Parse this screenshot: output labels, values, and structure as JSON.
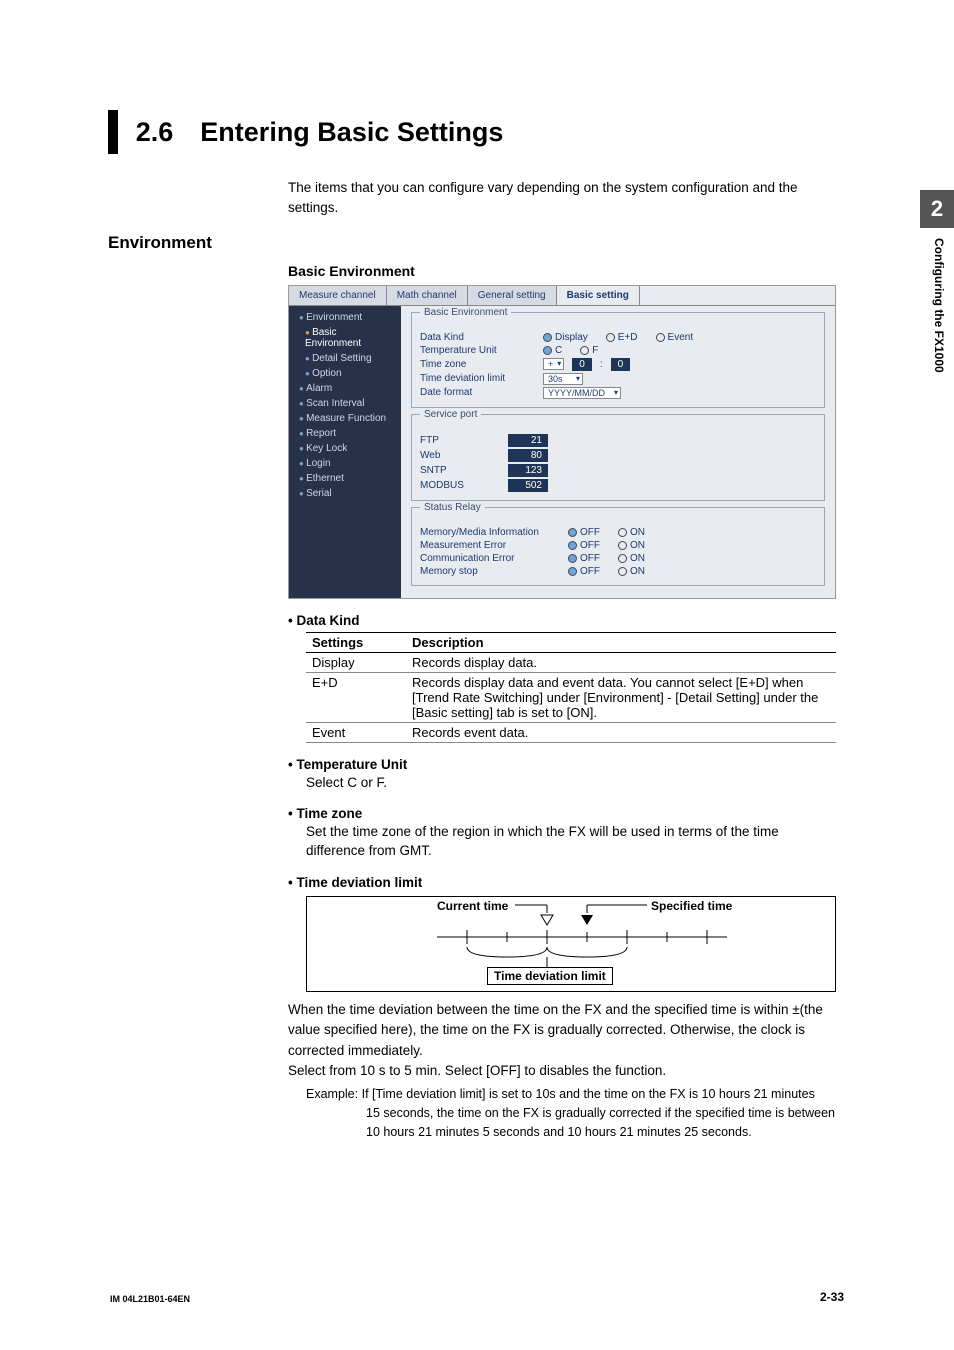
{
  "side_tab_number": "2",
  "side_tab_title": "Configuring the FX1000",
  "section_title": "2.6 Entering Basic Settings",
  "intro": "The items that you can configure vary depending on the system configuration and the settings.",
  "h2_environment": "Environment",
  "h3_basic_env": "Basic Environment",
  "screenshot": {
    "tabs": {
      "measure": "Measure channel",
      "math": "Math channel",
      "general": "General setting",
      "basic": "Basic setting"
    },
    "sidebar": {
      "environment": "Environment",
      "basic_env": "Basic Environment",
      "detail": "Detail Setting",
      "option": "Option",
      "alarm": "Alarm",
      "scan": "Scan Interval",
      "measure_fn": "Measure Function",
      "report": "Report",
      "keylock": "Key Lock",
      "login": "Login",
      "ethernet": "Ethernet",
      "serial": "Serial"
    },
    "fields": {
      "group_basic": "Basic Environment",
      "data_kind": "Data Kind",
      "dk_display": "Display",
      "dk_ed": "E+D",
      "dk_event": "Event",
      "temp": "Temperature Unit",
      "temp_c": "C",
      "temp_f": "F",
      "tz": "Time zone",
      "tz_sign": "+",
      "tz_h": "0",
      "tz_m": "0",
      "tdl": "Time deviation limit",
      "tdl_val": "30s",
      "datefmt": "Date format",
      "datefmt_val": "YYYY/MM/DD",
      "group_port": "Service port",
      "ftp": "FTP",
      "ftp_v": "21",
      "web": "Web",
      "web_v": "80",
      "sntp": "SNTP",
      "sntp_v": "123",
      "modbus": "MODBUS",
      "modbus_v": "502",
      "group_relay": "Status Relay",
      "mm_info": "Memory/Media Information",
      "me_err": "Measurement Error",
      "comm_err": "Communication Error",
      "mem_stop": "Memory stop",
      "off": "OFF",
      "on": "ON"
    }
  },
  "data_kind": {
    "heading": "Data Kind",
    "th1": "Settings",
    "th2": "Description",
    "r1s": "Display",
    "r1d": "Records display data.",
    "r2s": "E+D",
    "r2d": "Records display data and event data. You cannot select [E+D] when [Trend Rate Switching] under [Environment] - [Detail Setting] under the [Basic setting] tab is set to [ON].",
    "r3s": "Event",
    "r3d": "Records event data."
  },
  "temp_unit": {
    "heading": "Temperature Unit",
    "body": "Select C or F."
  },
  "timezone": {
    "heading": "Time zone",
    "body": "Set the time zone of the region in which the FX will be used in terms of the time difference from GMT."
  },
  "tdl_section": {
    "heading": "Time deviation limit",
    "current": "Current time",
    "specified": "Specified time",
    "label": "Time deviation limit",
    "p1": "When the time deviation between the time on the FX and the specified time is within ±(the value specified here), the time on the FX is gradually corrected. Otherwise, the clock is corrected immediately.",
    "p2": "Select from 10 s to 5 min.  Select [OFF] to disables the function.",
    "ex_lead": "Example:",
    "ex1": "If [Time deviation limit] is set to 10s and the time on the FX is 10 hours 21 minutes",
    "ex2": "15 seconds, the time on the FX is gradually corrected if the specified time is between",
    "ex3": "10 hours 21 minutes 5 seconds and 10 hours 21 minutes 25 seconds."
  },
  "footer_left": "IM 04L21B01-64EN",
  "footer_right": "2-33"
}
